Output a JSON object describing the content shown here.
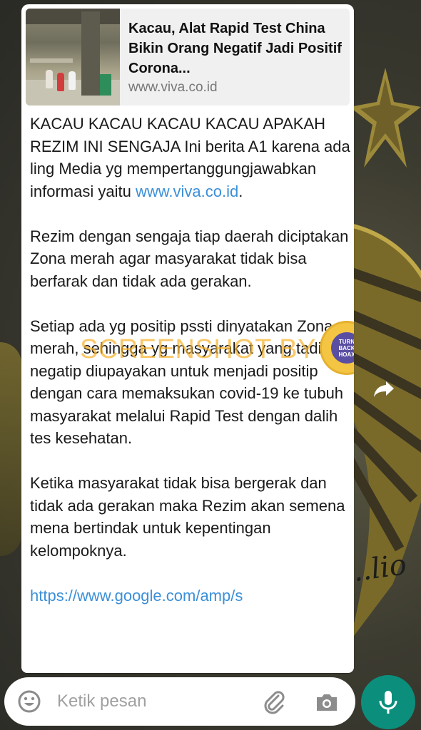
{
  "wallpaper": {
    "motto": "...lio"
  },
  "link_preview": {
    "title": "Kacau, Alat Rapid Test China Bikin Orang Negatif Jadi Positif Corona...",
    "domain": "www.viva.co.id"
  },
  "message": {
    "p1_text": "KACAU KACAU KACAU KACAU APAKAH REZIM INI SENGAJA Ini berita A1 karena ada ling Media yg mempertanggungjawabkan informasi yaitu ",
    "p1_link": "www.viva.co.id",
    "p1_end": ".",
    "p2": "Rezim dengan sengaja tiap daerah diciptakan Zona merah agar masyarakat tidak bisa berfarak dan tidak ada gerakan.",
    "p3": "Setiap ada yg positip pssti dinyatakan Zona merah, sehingga yg masyarakat yang tadinya negatip diupayakan untuk menjadi positip dengan cara memaksukan covid-19 ke tubuh masyarakat melalui Rapid Test dengan dalih tes kesehatan.",
    "p4": "Ketika masyarakat tidak bisa bergerak dan tidak ada gerakan maka Rezim akan semena mena bertindak untuk kepentingan kelompoknya.",
    "link": "https://www.google.com/amp/s"
  },
  "watermark": {
    "text": "SCREENSHOT BY",
    "logo_lines": [
      "TURN",
      "BACK",
      "HOAX"
    ],
    "logo_ring_text": "MASYARAKAT ANTI FITNAH INDONESIA"
  },
  "input": {
    "placeholder": "Ketik pesan"
  },
  "colors": {
    "link": "#3b8fd8",
    "mic_button": "#0b8f7c",
    "watermark": "#f7b028",
    "bubble": "#ffffff"
  },
  "icons": {
    "emoji": "emoji-icon",
    "attach": "paperclip-icon",
    "camera": "camera-icon",
    "mic": "mic-icon",
    "forward": "forward-arrow-icon"
  }
}
